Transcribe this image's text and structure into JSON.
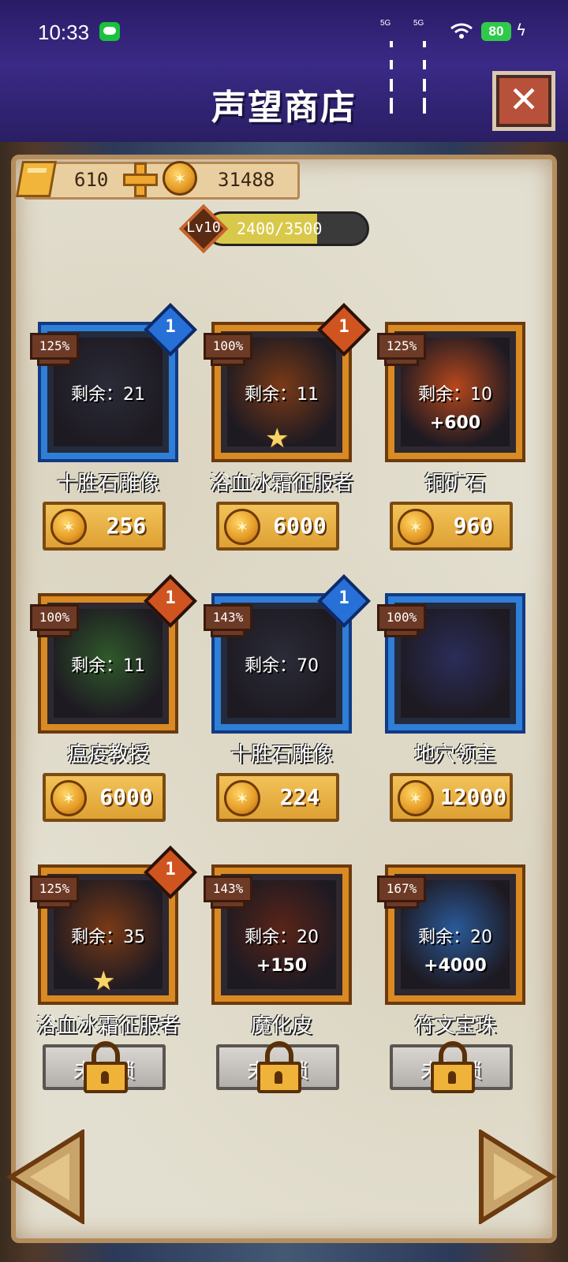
{
  "status_bar": {
    "time": "10:33",
    "signal_labels": [
      "5G",
      "5G"
    ],
    "battery": "80",
    "icons": [
      "wechat-icon",
      "signal-icon",
      "signal-icon",
      "wifi-icon",
      "battery-icon",
      "charging-icon"
    ]
  },
  "header": {
    "title": "声望商店",
    "close_icon": "close-icon"
  },
  "currency": {
    "gold_bars": "610",
    "coins": "31488",
    "add_icon": "plus-icon"
  },
  "level": {
    "label": "Lv10",
    "progress_text": "2400/3500",
    "current": 2400,
    "max": 3500
  },
  "items": [
    {
      "name": "十胜石雕像",
      "pct": "125%",
      "gem": "1",
      "gem_color": "blue",
      "remain": "剩余：21",
      "bonus": "",
      "star": false,
      "frame": "blue",
      "price": "256",
      "locked": false
    },
    {
      "name": "浴血冰霜征服者",
      "pct": "100%",
      "gem": "1",
      "gem_color": "orange",
      "remain": "剩余：11",
      "bonus": "",
      "star": true,
      "frame": "orange",
      "price": "6000",
      "locked": false
    },
    {
      "name": "铜矿石",
      "pct": "125%",
      "gem": "",
      "gem_color": "",
      "remain": "剩余：10",
      "bonus": "+600",
      "star": false,
      "frame": "orange",
      "price": "960",
      "locked": false
    },
    {
      "name": "瘟疫教授",
      "pct": "100%",
      "gem": "1",
      "gem_color": "orange",
      "remain": "剩余：11",
      "bonus": "",
      "star": false,
      "frame": "orange",
      "price": "6000",
      "locked": false
    },
    {
      "name": "十胜石雕像",
      "pct": "143%",
      "gem": "1",
      "gem_color": "blue",
      "remain": "剩余：70",
      "bonus": "",
      "star": false,
      "frame": "blue",
      "price": "224",
      "locked": false
    },
    {
      "name": "地穴领主",
      "pct": "100%",
      "gem": "",
      "gem_color": "",
      "remain": "",
      "bonus": "",
      "star": false,
      "frame": "blue",
      "price": "12000",
      "locked": false
    },
    {
      "name": "浴血冰霜征服者",
      "pct": "125%",
      "gem": "1",
      "gem_color": "orange",
      "remain": "剩余：35",
      "bonus": "",
      "star": true,
      "frame": "orange",
      "price": "",
      "locked": true
    },
    {
      "name": "魔化皮",
      "pct": "143%",
      "gem": "",
      "gem_color": "",
      "remain": "剩余：20",
      "bonus": "+150",
      "star": false,
      "frame": "orange",
      "price": "",
      "locked": true
    },
    {
      "name": "符文宝珠",
      "pct": "167%",
      "gem": "",
      "gem_color": "",
      "remain": "剩余：20",
      "bonus": "+4000",
      "star": false,
      "frame": "orange",
      "price": "",
      "locked": true
    }
  ],
  "locked_label": "未解锁",
  "nav": {
    "prev_icon": "arrow-left-icon",
    "next_icon": "arrow-right-icon"
  },
  "colors": {
    "header_bg": "#2a1b66",
    "parchment": "#e3dfd0",
    "orange_frame": "#d98a22",
    "blue_frame": "#2f7ed8",
    "price_gold": "#f2c259",
    "locked_gray": "#b3afaa"
  }
}
